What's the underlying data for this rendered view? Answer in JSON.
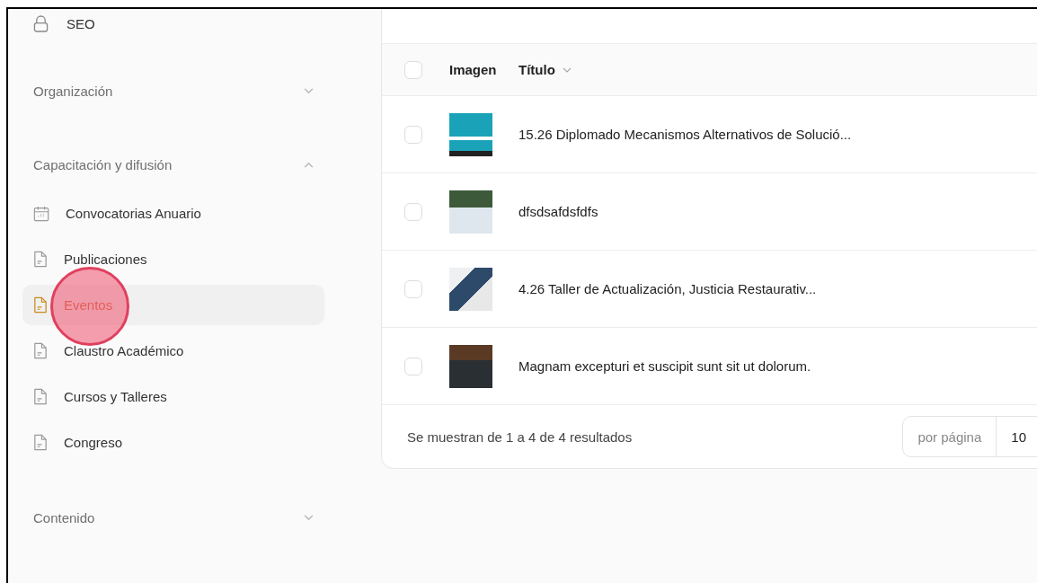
{
  "sidebar": {
    "top_item": {
      "label": "SEO"
    },
    "groups": [
      {
        "label": "Organización",
        "expanded": false
      },
      {
        "label": "Capacitación y difusión",
        "expanded": true,
        "items": [
          {
            "label": "Convocatorias Anuario",
            "kind": "calendar",
            "selected": false
          },
          {
            "label": "Publicaciones",
            "kind": "document",
            "selected": false
          },
          {
            "label": "Eventos",
            "kind": "document",
            "selected": true
          },
          {
            "label": "Claustro Académico",
            "kind": "document",
            "selected": false
          },
          {
            "label": "Cursos y Talleres",
            "kind": "document",
            "selected": false
          },
          {
            "label": "Congreso",
            "kind": "document",
            "selected": false
          }
        ]
      },
      {
        "label": "Contenido",
        "expanded": false
      }
    ]
  },
  "table": {
    "select_all": {
      "checked": false
    },
    "columns": [
      {
        "label": "Imagen",
        "sorted": false
      },
      {
        "label": "Título",
        "sorted": true
      }
    ],
    "rows": [
      {
        "checked": false,
        "title": "15.26 Diplomado Mecanismos Alternativos de Solució..."
      },
      {
        "checked": false,
        "title": "dfsdsafdsfdfs"
      },
      {
        "checked": false,
        "title": "4.26 Taller de Actualización, Justicia Restaurativ..."
      },
      {
        "checked": false,
        "title": "Magnam excepturi et suscipit sunt sit ut dolorum."
      }
    ],
    "footer": {
      "summary": "Se muestran de 1 a 4 de 4 resultados",
      "per_page_label": "por página",
      "per_page_value": "10"
    }
  },
  "click_indicator": {
    "shown": true
  }
}
